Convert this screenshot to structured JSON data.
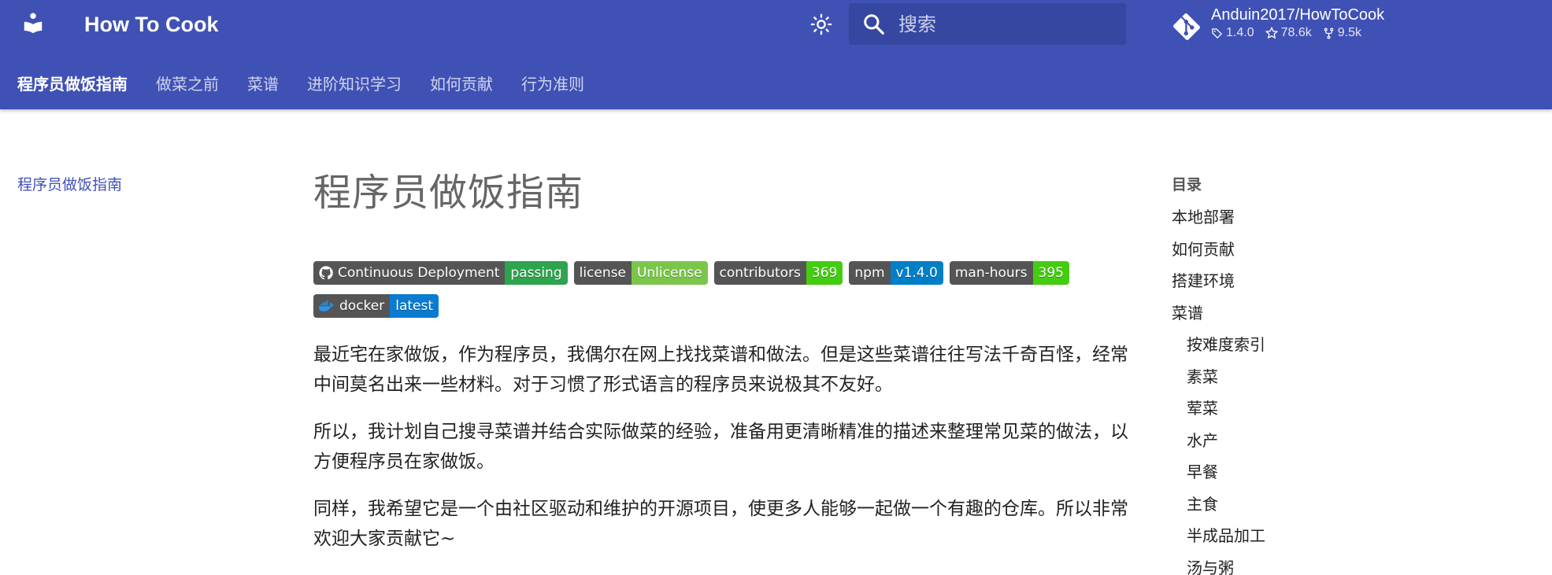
{
  "header": {
    "site_title": "How To Cook",
    "logo_icon": "book-reader-icon",
    "search_placeholder": "搜索",
    "repo": {
      "name": "Anduin2017/HowToCook",
      "version": "1.4.0",
      "stars": "78.6k",
      "forks": "9.5k"
    },
    "tabs": [
      {
        "label": "程序员做饭指南",
        "active": true
      },
      {
        "label": "做菜之前",
        "active": false
      },
      {
        "label": "菜谱",
        "active": false
      },
      {
        "label": "进阶知识学习",
        "active": false
      },
      {
        "label": "如何贡献",
        "active": false
      },
      {
        "label": "行为准则",
        "active": false
      }
    ]
  },
  "left_nav": {
    "active_link": "程序员做饭指南"
  },
  "main": {
    "title": "程序员做饭指南",
    "badges": [
      {
        "left": "Continuous Deployment",
        "right": "passing",
        "color": "#2ea44f",
        "icon": "github-icon"
      },
      {
        "left": "license",
        "right": "Unlicense",
        "color": "#7bc64a",
        "icon": ""
      },
      {
        "left": "contributors",
        "right": "369",
        "color": "#4c1",
        "icon": ""
      },
      {
        "left": "npm",
        "right": "v1.4.0",
        "color": "#007ec6",
        "icon": ""
      },
      {
        "left": "man-hours",
        "right": "395",
        "color": "#4c1",
        "icon": ""
      },
      {
        "left": "docker",
        "right": "latest",
        "color": "#0a7bd0",
        "icon": "docker-icon"
      }
    ],
    "paragraphs": [
      "最近宅在家做饭，作为程序员，我偶尔在网上找找菜谱和做法。但是这些菜谱往往写法千奇百怪，经常中间莫名出来一些材料。对于习惯了形式语言的程序员来说极其不友好。",
      "所以，我计划自己搜寻菜谱并结合实际做菜的经验，准备用更清晰精准的描述来整理常见菜的做法，以方便程序员在家做饭。",
      "同样，我希望它是一个由社区驱动和维护的开源项目，使更多人能够一起做一个有趣的仓库。所以非常欢迎大家贡献它~"
    ]
  },
  "toc": {
    "title": "目录",
    "items": [
      {
        "label": "本地部署",
        "sub": false
      },
      {
        "label": "如何贡献",
        "sub": false
      },
      {
        "label": "搭建环境",
        "sub": false
      },
      {
        "label": "菜谱",
        "sub": false
      },
      {
        "label": "按难度索引",
        "sub": true
      },
      {
        "label": "素菜",
        "sub": true
      },
      {
        "label": "荤菜",
        "sub": true
      },
      {
        "label": "水产",
        "sub": true
      },
      {
        "label": "早餐",
        "sub": true
      },
      {
        "label": "主食",
        "sub": true
      },
      {
        "label": "半成品加工",
        "sub": true
      },
      {
        "label": "汤与粥",
        "sub": true
      }
    ]
  },
  "colors": {
    "primary": "#4051b5",
    "search_bg": "#3547a1",
    "link": "#4051b5"
  }
}
